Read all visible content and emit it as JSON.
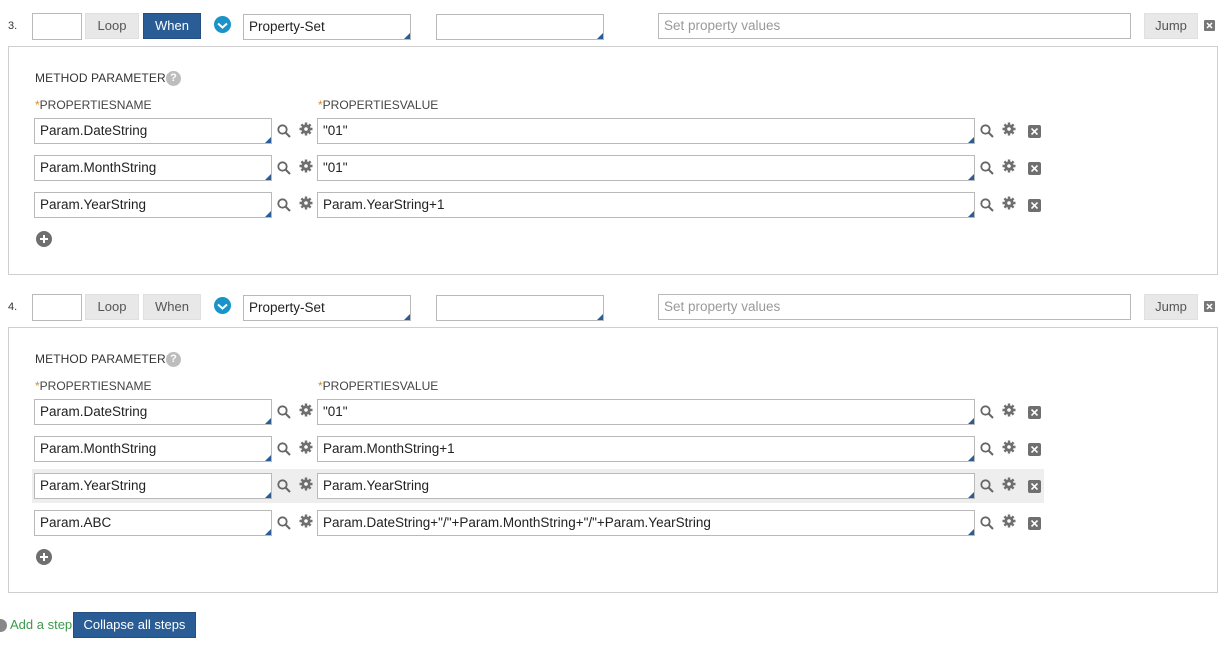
{
  "steps": [
    {
      "number": "3.",
      "loop_label": "Loop",
      "when_label": "When",
      "when_active": true,
      "action": "Property-Set",
      "condition": "",
      "description_placeholder": "Set property values",
      "jump_label": "Jump",
      "method_parameters_label": "METHOD PARAMETERS",
      "col_name": "PROPERTIESNAME",
      "col_value": "PROPERTIESVALUE",
      "rows": [
        {
          "name": "Param.DateString",
          "value": "\"01\""
        },
        {
          "name": "Param.MonthString",
          "value": "\"01\""
        },
        {
          "name": "Param.YearString",
          "value": "Param.YearString+1"
        }
      ]
    },
    {
      "number": "4.",
      "loop_label": "Loop",
      "when_label": "When",
      "when_active": false,
      "action": "Property-Set",
      "condition": "",
      "description_placeholder": "Set property values",
      "jump_label": "Jump",
      "method_parameters_label": "METHOD PARAMETERS",
      "col_name": "PROPERTIESNAME",
      "col_value": "PROPERTIESVALUE",
      "rows": [
        {
          "name": "Param.DateString",
          "value": "\"01\""
        },
        {
          "name": "Param.MonthString",
          "value": "Param.MonthString+1"
        },
        {
          "name": "Param.YearString",
          "value": "Param.YearString",
          "highlighted": true
        },
        {
          "name": "Param.ABC",
          "value": "Param.DateString+\"/\"+Param.MonthString+\"/\"+Param.YearString"
        }
      ]
    }
  ],
  "footer": {
    "add_step_label": "Add a step",
    "collapse_label": "Collapse all steps"
  },
  "colors": {
    "primary_button": "#2a5d95",
    "check_circle": "#1a93c8",
    "required_star": "#e08a1e",
    "add_step_link": "#3a9a4a"
  }
}
